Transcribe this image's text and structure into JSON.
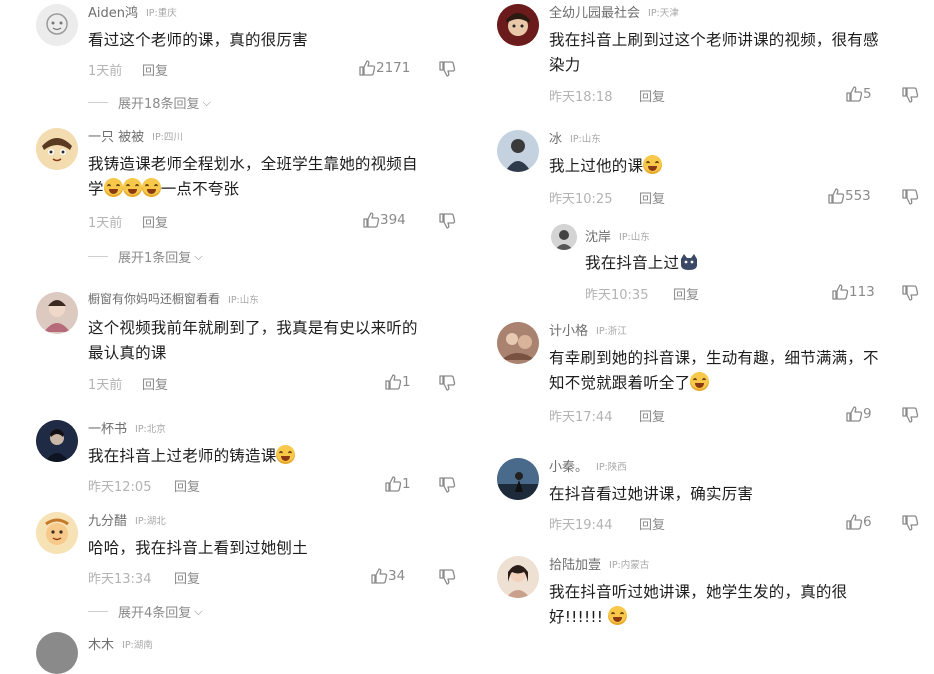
{
  "comments_left": [
    {
      "name": "Aiden鸿",
      "ip": "IP:重庆",
      "text": "看过这个老师的课，真的很厉害",
      "time": "1天前",
      "reply": "回复",
      "likes": "2171",
      "expand": "展开18条回复"
    },
    {
      "name": "一只 被被",
      "ip": "IP:四川",
      "text_a": "我铸造课老师全程划水，全班学生靠她的视频自",
      "text_b": "学",
      "text_c": "一点不夸张",
      "time": "1天前",
      "reply": "回复",
      "likes": "394",
      "expand": "展开1条回复"
    },
    {
      "name": "橱窗有你妈吗还橱窗看看",
      "ip": "IP:山东",
      "text_a": "这个视频我前年就刷到了，我真是有史以来听的",
      "text_b": "最认真的课",
      "time": "1天前",
      "reply": "回复",
      "likes": "1"
    },
    {
      "name": "一杯书",
      "ip": "IP:北京",
      "text": "我在抖音上过老师的铸造课",
      "time": "昨天12:05",
      "reply": "回复",
      "likes": "1"
    },
    {
      "name": "九分醋",
      "ip": "IP:湖北",
      "text": "哈哈，我在抖音上看到过她刨土",
      "time": "昨天13:34",
      "reply": "回复",
      "likes": "34",
      "expand": "展开4条回复"
    },
    {
      "name": "木木",
      "ip": "IP:湖南"
    }
  ],
  "comments_right": [
    {
      "name": "全幼儿园最社会",
      "ip": "IP:天津",
      "text_a": "我在抖音上刷到过这个老师讲课的视频，很有感",
      "text_b": "染力",
      "time": "昨天18:18",
      "reply": "回复",
      "likes": "5"
    },
    {
      "name": "冰",
      "ip": "IP:山东",
      "text": "我上过他的课",
      "time": "昨天10:25",
      "reply": "回复",
      "likes": "553"
    },
    {
      "name": "沈岸",
      "ip": "IP:山东",
      "text": "我在抖音上过",
      "time": "昨天10:35",
      "reply": "回复",
      "likes": "113"
    },
    {
      "name": "计小格",
      "ip": "IP:浙江",
      "text_a": "有幸刷到她的抖音课，生动有趣，细节满满，不",
      "text_b": "知不觉就跟着听全了",
      "time": "昨天17:44",
      "reply": "回复",
      "likes": "9"
    },
    {
      "name": "小秦。",
      "ip": "IP:陕西",
      "text": "在抖音看过她讲课，确实厉害",
      "time": "昨天19:44",
      "reply": "回复",
      "likes": "6"
    },
    {
      "name": "拾陆加壹",
      "ip": "IP:内蒙古",
      "text_a": "我在抖音听过她讲课，她学生发的，真的很",
      "text_b": "好!!!!!!"
    }
  ],
  "icons": {
    "like": "thumbs-up-icon",
    "dislike": "thumbs-down-icon",
    "chevron": "chevron-down-icon"
  },
  "colors": {
    "meta": "#b3b3b3",
    "text": "#1d1d1d",
    "emoji": "#f7c84a"
  }
}
